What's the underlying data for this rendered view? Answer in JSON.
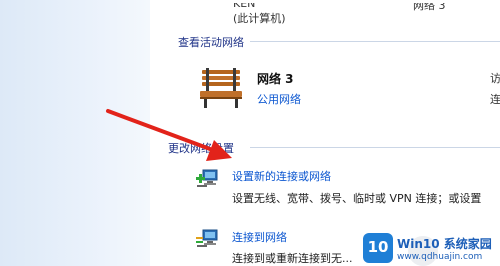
{
  "top": {
    "computer_name": "KEN",
    "computer_sub": "(此计算机)",
    "network_fragment": "网络 3"
  },
  "active_networks": {
    "section_title": "查看活动网络",
    "network_name": "网络 3",
    "network_type": "公用网络",
    "right_fragment_1": "访",
    "right_fragment_2": "连"
  },
  "change_settings": {
    "section_title": "更改网络设置",
    "tasks": [
      {
        "link": "设置新的连接或网络",
        "desc": "设置无线、宽带、拨号、临时或 VPN 连接；或设置",
        "icon": "new-connection-icon"
      },
      {
        "link": "连接到网络",
        "desc": "连接到或重新连接到无...",
        "icon": "connect-network-icon"
      }
    ]
  },
  "watermark": {
    "badge": "10",
    "brand": "Win10 系统家园",
    "url": "www.qdhuajin.com"
  },
  "colors": {
    "link": "#0b56d0",
    "section_title": "#1e3287",
    "arrow": "#e2231a"
  }
}
